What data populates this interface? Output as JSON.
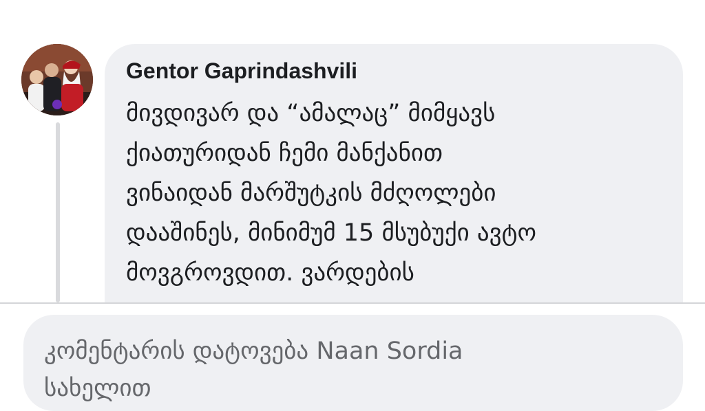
{
  "comment": {
    "author": "Gentor Gaprindashvili",
    "text": "მივდივარ და “ამალაც” მიმყავს\nქიათურიდან ჩემი მანქანით\nვინაიდან მარშუტკის მძღოლები\nდააშინეს, მინიმუმ 15 მსუბუქი ავტო\nმოვგროვდით. ვარდების",
    "avatar_icon": "profile-photo"
  },
  "reply": {
    "placeholder": "კომენტარის დატოვება Naan Sordia\nსახელით"
  },
  "colors": {
    "bubble_bg": "#eff0f3",
    "text": "#1c1e21",
    "placeholder": "#65676b",
    "divider": "#d4d5d8"
  }
}
